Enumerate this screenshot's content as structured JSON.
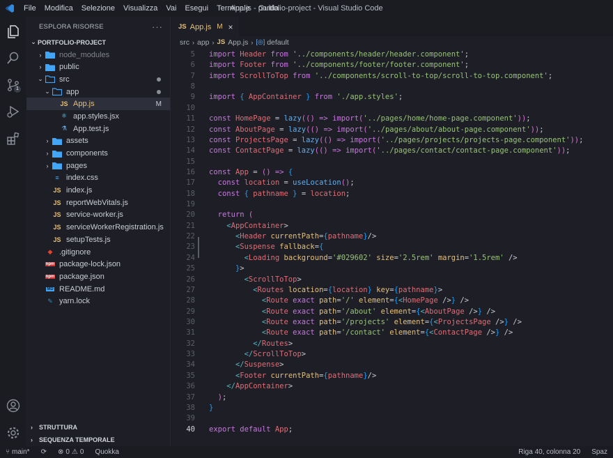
{
  "window": {
    "title": "App.js - portfolio-project - Visual Studio Code"
  },
  "menu": [
    "File",
    "Modifica",
    "Selezione",
    "Visualizza",
    "Vai",
    "Esegui",
    "Terminale",
    "Guida"
  ],
  "activity_bar": {
    "scm_badge": "1"
  },
  "explorer": {
    "header": "ESPLORA RISORSE",
    "more": "···",
    "project": "PORTFOLIO-PROJECT",
    "items": [
      {
        "label": "node_modules",
        "kind": "folder",
        "depth": 1
      },
      {
        "label": "public",
        "kind": "folder",
        "depth": 1
      },
      {
        "label": "src",
        "kind": "folder-open",
        "depth": 1
      },
      {
        "label": "app",
        "kind": "folder-open",
        "depth": 2
      },
      {
        "label": "App.js",
        "kind": "js",
        "depth": 3,
        "status": "M"
      },
      {
        "label": "app.styles.jsx",
        "kind": "jsx",
        "depth": 3
      },
      {
        "label": "App.test.js",
        "kind": "test",
        "depth": 3
      },
      {
        "label": "assets",
        "kind": "folder",
        "depth": 2
      },
      {
        "label": "components",
        "kind": "folder",
        "depth": 2
      },
      {
        "label": "pages",
        "kind": "folder",
        "depth": 2
      },
      {
        "label": "index.css",
        "kind": "css",
        "depth": 2
      },
      {
        "label": "index.js",
        "kind": "js",
        "depth": 2
      },
      {
        "label": "reportWebVitals.js",
        "kind": "js",
        "depth": 2
      },
      {
        "label": "service-worker.js",
        "kind": "js",
        "depth": 2
      },
      {
        "label": "serviceWorkerRegistration.js",
        "kind": "js",
        "depth": 2
      },
      {
        "label": "setupTests.js",
        "kind": "js",
        "depth": 2
      },
      {
        "label": ".gitignore",
        "kind": "git",
        "depth": 1
      },
      {
        "label": "package-lock.json",
        "kind": "npm",
        "depth": 1
      },
      {
        "label": "package.json",
        "kind": "npm",
        "depth": 1
      },
      {
        "label": "README.md",
        "kind": "md",
        "depth": 1
      },
      {
        "label": "yarn.lock",
        "kind": "yarn",
        "depth": 1
      }
    ],
    "outline": "STRUTTURA",
    "timeline": "SEQUENZA TEMPORALE"
  },
  "tab": {
    "icon": "JS",
    "name": "App.js",
    "status": "M",
    "close": "×"
  },
  "breadcrumb": {
    "parts": [
      "src",
      "app",
      "App.js",
      "default"
    ],
    "js_icon": "JS"
  },
  "code": {
    "current_line": 40,
    "lines": [
      {
        "n": 5,
        "text": "import Header from '../components/header/header.component';"
      },
      {
        "n": 6,
        "text": "import Footer from '../components/footer/footer.component';"
      },
      {
        "n": 7,
        "text": "import ScrollToTop from '../components/scroll-to-top/scroll-to-top.component';"
      },
      {
        "n": 8,
        "text": ""
      },
      {
        "n": 9,
        "text": "import { AppContainer } from './app.styles';"
      },
      {
        "n": 10,
        "text": ""
      },
      {
        "n": 11,
        "text": "const HomePage = lazy(() => import('../pages/home/home-page.component'));"
      },
      {
        "n": 12,
        "text": "const AboutPage = lazy(() => import('../pages/about/about-page.component'));"
      },
      {
        "n": 13,
        "text": "const ProjectsPage = lazy(() => import('../pages/projects/projects-page.component'));"
      },
      {
        "n": 14,
        "text": "const ContactPage = lazy(() => import('../pages/contact/contact-page.component'));"
      },
      {
        "n": 15,
        "text": ""
      },
      {
        "n": 16,
        "text": "const App = () => {"
      },
      {
        "n": 17,
        "text": "  const location = useLocation();"
      },
      {
        "n": 18,
        "text": "  const { pathname } = location;"
      },
      {
        "n": 19,
        "text": ""
      },
      {
        "n": 20,
        "text": "  return ("
      },
      {
        "n": 21,
        "text": "    <AppContainer>"
      },
      {
        "n": 22,
        "text": "      <Header currentPath={pathname}/>"
      },
      {
        "n": 23,
        "text": "      <Suspense fallback={"
      },
      {
        "n": 24,
        "text": "        <Loading background='#029602' size='2.5rem' margin='1.5rem' />"
      },
      {
        "n": 25,
        "text": "      }>"
      },
      {
        "n": 26,
        "text": "        <ScrollToTop>"
      },
      {
        "n": 27,
        "text": "          <Routes location={location} key={pathname}>"
      },
      {
        "n": 28,
        "text": "            <Route exact path='/' element={<HomePage />} />"
      },
      {
        "n": 29,
        "text": "            <Route exact path='/about' element={<AboutPage />} />"
      },
      {
        "n": 30,
        "text": "            <Route exact path='/projects' element={<ProjectsPage />} />"
      },
      {
        "n": 31,
        "text": "            <Route exact path='/contact' element={<ContactPage />} />"
      },
      {
        "n": 32,
        "text": "          </Routes>"
      },
      {
        "n": 33,
        "text": "        </ScrollToTop>"
      },
      {
        "n": 34,
        "text": "      </Suspense>"
      },
      {
        "n": 35,
        "text": "      <Footer currentPath={pathname}/>"
      },
      {
        "n": 36,
        "text": "    </AppContainer>"
      },
      {
        "n": 37,
        "text": "  );"
      },
      {
        "n": 38,
        "text": "}"
      },
      {
        "n": 39,
        "text": ""
      },
      {
        "n": 40,
        "text": "export default App;"
      }
    ]
  },
  "statusbar": {
    "branch": "main*",
    "errors": "0",
    "warnings": "0",
    "extension": "Quokka",
    "position": "Riga 40, colonna 20",
    "spaces": "Spaz"
  },
  "colors": {
    "accent": "#e5c07b",
    "keyword": "#c678dd",
    "variable": "#e06c75",
    "string": "#98c379",
    "function": "#61afef",
    "background": "#1e1f26"
  }
}
